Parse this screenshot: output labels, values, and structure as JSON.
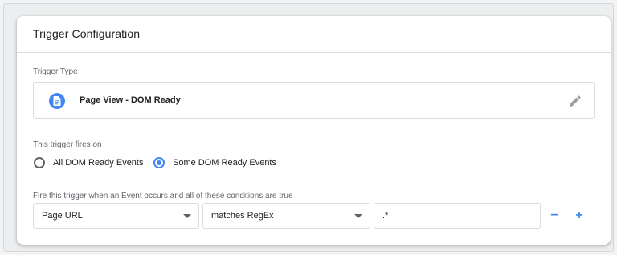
{
  "card": {
    "title": "Trigger Configuration"
  },
  "trigger_type": {
    "label": "Trigger Type",
    "name": "Page View - DOM Ready",
    "icon": "document-icon",
    "edit_icon": "pencil-icon"
  },
  "fires_on": {
    "label": "This trigger fires on",
    "options": [
      {
        "label": "All DOM Ready Events",
        "checked": false
      },
      {
        "label": "Some DOM Ready Events",
        "checked": true
      }
    ]
  },
  "condition": {
    "label": "Fire this trigger when an Event occurs and all of these conditions are true",
    "variable": "Page URL",
    "operator": "matches RegEx",
    "value": ".*",
    "remove_label": "−",
    "add_label": "+"
  },
  "colors": {
    "accent": "#4285f4",
    "border": "#dadce0",
    "label": "#5f6368"
  }
}
